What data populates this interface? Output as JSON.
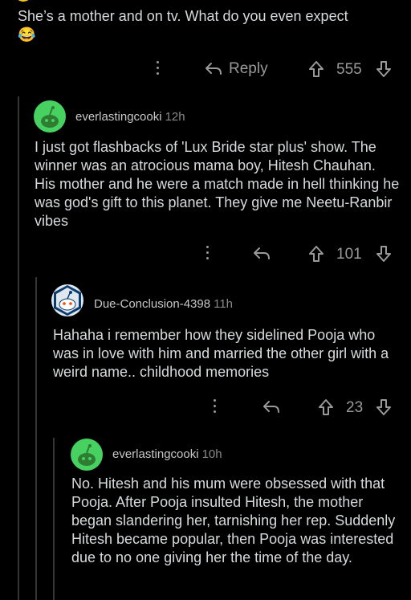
{
  "top_comment": {
    "text": "She’s a mother and on tv. What do you even expect",
    "emoji": "😂",
    "reply_label": "Reply",
    "votes": "555"
  },
  "comments": [
    {
      "author": "everlastingcooki",
      "age": "12h",
      "text": "I just got flashbacks of 'Lux Bride star plus' show. The winner was an atrocious mama boy, Hitesh Chauhan. His mother and he were a match made in hell thinking he was god's gift to this planet. They give me Neetu-Ranbir vibes",
      "votes": "101"
    },
    {
      "author": "Due-Conclusion-4398",
      "age": "11h",
      "text": "Hahaha i remember how they sidelined Pooja who was in love with him and married the other girl with a weird name.. childhood memories",
      "votes": "23"
    },
    {
      "author": "everlastingcooki",
      "age": "10h",
      "text": "No. Hitesh and his mum were obsessed with that Pooja. After Pooja insulted Hitesh, the mother began slandering her, tarnishing her rep. Suddenly Hitesh became popular, then Pooja was interested due to no one giving her the time of the day."
    }
  ],
  "colors": {
    "background": "#000000",
    "text": "#d7dadc",
    "muted": "#9a9a9a",
    "avatar_green": "#46d160",
    "thread_line": "#343536"
  }
}
